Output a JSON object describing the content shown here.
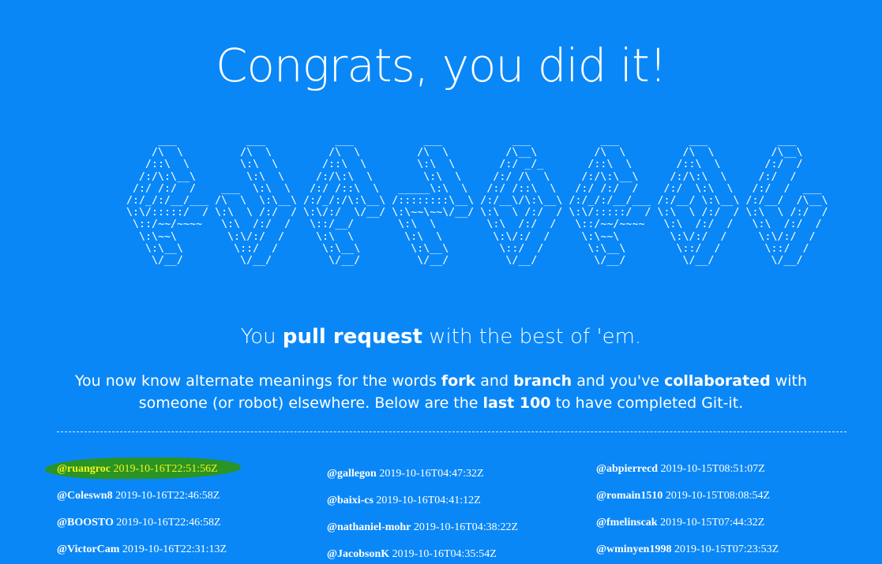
{
  "headline": "Congrats, you did it!",
  "ascii_art": "      ___           ___           ___           ___           ___           ___           ___           ___     \n     /\\  \\         /\\  \\         /\\  \\         /\\  \\         /\\__\\         /\\  \\         /\\  \\         /\\__\\    \n    /::\\  \\        \\:\\  \\       /::\\  \\        \\:\\  \\       /:/ _/_       /::\\  \\       /::\\  \\       /:/  /    \n   /:/\\:\\__\\        \\:\\  \\     /:/\\:\\  \\        \\:\\  \\     /:/ /\\  \\     /:/\\:\\__\\     /:/\\:\\  \\     /:/  /     \n  /:/ /:/  /    ___  \\:\\  \\   /:/ /::\\  \\   _____\\:\\  \\   /:/ /::\\  \\   /:/ /:/  /    /:/  \\:\\  \\   /:/  /  ___ \n /:/_/:/__/___ /\\  \\  \\:\\__\\ /:/_/:/\\:\\__\\ /::::::::\\__\\ /:/__\\/\\:\\__\\ /:/_/:/__/___ /:/__/ \\:\\__\\ /:/__/  /\\__\\\n \\:\\/:::::/  / \\:\\  \\ /:/  / \\:\\/:/  \\/__/ \\:\\~~\\~~\\/__/ \\:\\  \\ /:/  / \\:\\/:::::/  / \\:\\  \\ /:/  / \\:\\  \\ /:/  /\n  \\::/~~/~~~~   \\:\\  /:/  /   \\::/__/       \\:\\  \\        \\:\\  /:/  /   \\::/~~/~~~~   \\:\\  /:/  /   \\:\\  /:/  / \n   \\:\\~~\\        \\:\\/:/  /     \\:\\  \\        \\:\\  \\        \\:\\/:/  /     \\:\\~~\\        \\:\\/:/  /     \\:\\/:/  /  \n    \\:\\__\\        \\::/  /       \\:\\__\\        \\:\\__\\        \\::/  /       \\:\\__\\        \\::/  /       \\::/  /   \n     \\/__/         \\/__/         \\/__/         \\/__/         \\/__/         \\/__/         \\/__/         \\/__/    ",
  "tagline": {
    "pre": "You ",
    "bold": "pull request",
    "post": " with the best of 'em."
  },
  "intro": {
    "p1": "You now know alternate meanings for the words ",
    "b1": "fork",
    "p2": " and ",
    "b2": "branch",
    "p3": " and you've ",
    "b3": "collaborated",
    "p4": " with someone (or robot) elsewhere. Below are the ",
    "b4": "last 100",
    "p5": " to have completed Git-it."
  },
  "completions": {
    "column1": [
      {
        "user": "@ruangroc",
        "time": "2019-10-16T22:51:56Z"
      },
      {
        "user": "@Coleswn8",
        "time": "2019-10-16T22:46:58Z"
      },
      {
        "user": "@BOOSTO",
        "time": "2019-10-16T22:46:58Z"
      },
      {
        "user": "@VictorCam",
        "time": "2019-10-16T22:31:13Z"
      }
    ],
    "column2": [
      {
        "user": "@gallegon",
        "time": "2019-10-16T04:47:32Z"
      },
      {
        "user": "@baixi-cs",
        "time": "2019-10-16T04:41:12Z"
      },
      {
        "user": "@nathaniel-mohr",
        "time": "2019-10-16T04:38:22Z"
      },
      {
        "user": "@JacobsonK",
        "time": "2019-10-16T04:35:54Z"
      }
    ],
    "column3": [
      {
        "user": "@abpierrecd",
        "time": "2019-10-15T08:51:07Z"
      },
      {
        "user": "@romain1510",
        "time": "2019-10-15T08:08:54Z"
      },
      {
        "user": "@fmelinscak",
        "time": "2019-10-15T07:44:32Z"
      },
      {
        "user": "@wminyen1998",
        "time": "2019-10-15T07:23:53Z"
      }
    ]
  },
  "colors": {
    "background": "#0a87f7",
    "highlight_marker": "#2a9424",
    "highlight_text": "#f4f518"
  }
}
